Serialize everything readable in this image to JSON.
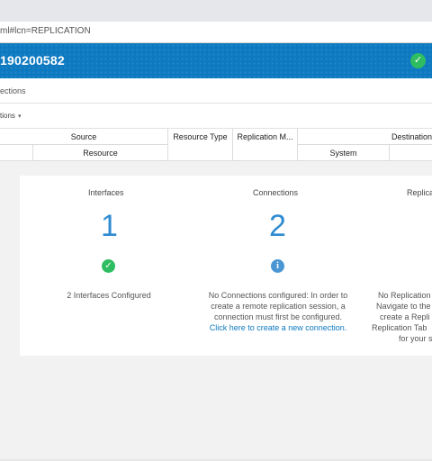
{
  "browser": {
    "url_fragment": "ml#lcn=REPLICATION"
  },
  "app": {
    "system_name": "190200582"
  },
  "tabs": {
    "current": "ections"
  },
  "filter": {
    "label": "tions"
  },
  "table": {
    "group_source": "Source",
    "sub_resource": "Resource",
    "resource_type": "Resource Type",
    "replication_mode": "Replication M...",
    "group_destination": "Destination",
    "sub_system": "System"
  },
  "dashboard": {
    "interfaces": {
      "title": "Interfaces",
      "count": "1",
      "status_icon": "check-circle-icon",
      "status_color": "#2ebd60",
      "desc": "2 Interfaces Configured"
    },
    "connections": {
      "title": "Connections",
      "count": "2",
      "status_icon": "info-circle-icon",
      "status_color": "#4a97d4",
      "desc_line1": "No Connections configured: In order to",
      "desc_line2": "create a remote replication session, a",
      "desc_line3": "connection must first be configured.",
      "link": "Click here to create a new connection."
    },
    "replication": {
      "title": "Replica",
      "desc_line1": "No Replication",
      "desc_line2": "Navigate to the",
      "desc_line3": "create a Repli",
      "desc_line4": "Replication Tab",
      "desc_line5": "for your s"
    }
  }
}
